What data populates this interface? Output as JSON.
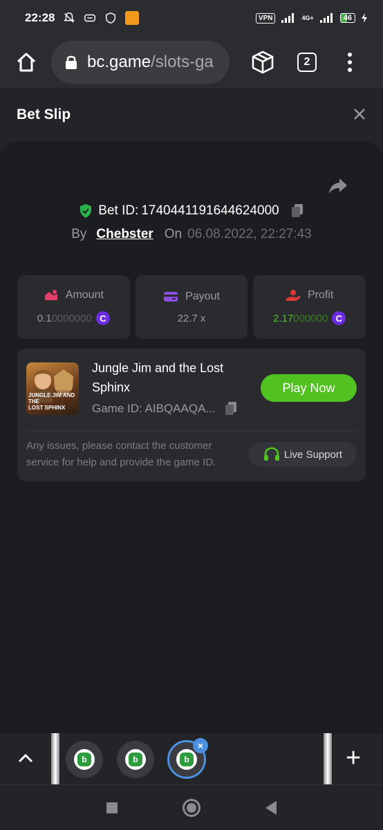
{
  "status_bar": {
    "time": "22:28",
    "vpn": "VPN",
    "network": "4G+",
    "battery": "46"
  },
  "browser": {
    "url_host": "bc.game",
    "url_path": "/slots-ga",
    "tab_count": "2"
  },
  "bet_slip": {
    "title": "Bet Slip",
    "bet_id_label": "Bet ID:",
    "bet_id": "1740441191644624000",
    "by_label": "By",
    "user": "Chebster",
    "on_label": "On",
    "date": "06.08.2022, 22:27:43",
    "stats": {
      "amount_label": "Amount",
      "amount_main": "0.1",
      "amount_rest": "0000000",
      "payout_label": "Payout",
      "payout_value": "22.7 x",
      "profit_label": "Profit",
      "profit_main": "2.17",
      "profit_rest": "000000"
    },
    "coin_symbol": "C",
    "game": {
      "title": "Jungle Jim and the Lost Sphinx",
      "thumb_text_1": "JUNGLE JIM AND THE",
      "thumb_text_2": "LOST SPHINX",
      "game_id_label": "Game ID:",
      "game_id": "AIBQAAQA...",
      "play_label": "Play Now"
    },
    "help_text": "Any issues, please contact the customer service for help and provide the game ID.",
    "support_label": "Live Support"
  },
  "tab_strip": {
    "close_symbol": "×",
    "plus_symbol": "+",
    "bc_letter": "b"
  },
  "colors": {
    "accent_green": "#51c21f",
    "coin_purple": "#6c2de0",
    "tab_active": "#4a8fe0",
    "profit_green": "#51c21f"
  }
}
